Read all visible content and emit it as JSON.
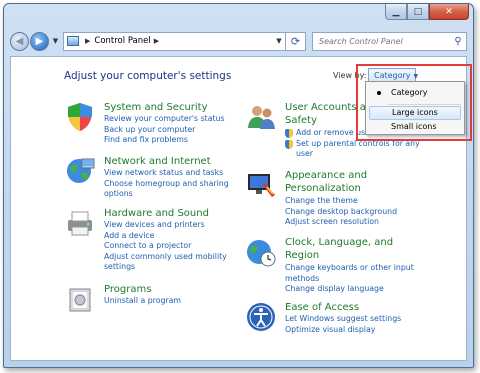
{
  "breadcrumb": {
    "root": "Control Panel"
  },
  "search": {
    "placeholder": "Search Control Panel"
  },
  "main": {
    "heading": "Adjust your computer's settings",
    "view_by_label": "View by:",
    "view_by_value": "Category"
  },
  "dropdown": {
    "items": [
      "Category",
      "Large icons",
      "Small icons"
    ],
    "selected": "Category",
    "hovered": "Large icons"
  },
  "categories": [
    {
      "title": "System and Security",
      "links": [
        "Review your computer's status",
        "Back up your computer",
        "Find and fix problems"
      ]
    },
    {
      "title": "Network and Internet",
      "links": [
        "View network status and tasks",
        "Choose homegroup and sharing",
        "options"
      ]
    },
    {
      "title": "Hardware and Sound",
      "links": [
        "View devices and printers",
        "Add a device",
        "Connect to a projector",
        "Adjust commonly used mobility",
        "settings"
      ]
    },
    {
      "title": "Programs",
      "links": [
        "Uninstall a program"
      ]
    },
    {
      "title": "User Accounts and",
      "title2": "Safety",
      "links": [
        "Add or remove user accounts",
        "Set up parental controls for any",
        "user"
      ]
    },
    {
      "title": "Appearance and",
      "title2": "Personalization",
      "links": [
        "Change the theme",
        "Change desktop background",
        "Adjust screen resolution"
      ]
    },
    {
      "title": "Clock, Language, and",
      "title2": "Region",
      "links": [
        "Change keyboards or other input",
        "methods",
        "Change display language"
      ]
    },
    {
      "title": "Ease of Access",
      "links": [
        "Let Windows suggest settings",
        "Optimize visual display"
      ]
    }
  ]
}
